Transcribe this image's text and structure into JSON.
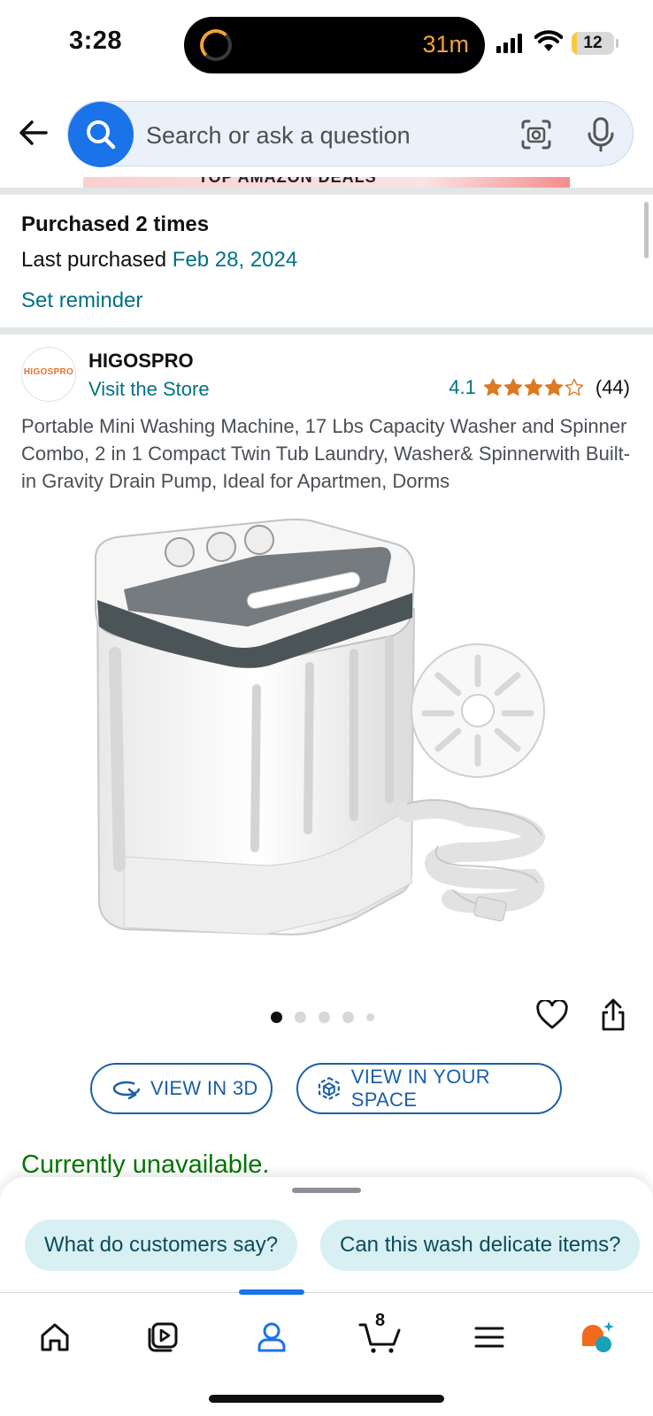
{
  "status_bar": {
    "time": "3:28",
    "activity_text": "31m",
    "battery_level": "12",
    "battery_fraction": 0.12
  },
  "search": {
    "placeholder": "Search or ask a question"
  },
  "purchase_history": {
    "title": "Purchased 2 times",
    "last_purchased_label": "Last purchased",
    "last_purchased_date": "Feb 28, 2024",
    "reminder_link": "Set reminder"
  },
  "brand": {
    "logo_text": "HIGOSPRO",
    "name": "HIGOSPRO",
    "store_link": "Visit the Store"
  },
  "rating": {
    "value": "4.1",
    "stars": 4.1,
    "count": "(44)",
    "star_color": "#de7921"
  },
  "product": {
    "title": "Portable Mini Washing Machine, 17 Lbs Capacity Washer and Spinner Combo, 2 in 1 Compact Twin Tub Laundry, Washer& Spinnerwith Built-in Gravity Drain Pump, Ideal for Apartmen, Dorms",
    "image_count": 5,
    "active_image": 1
  },
  "actions": {
    "view_3d": "VIEW IN 3D",
    "view_space": "VIEW IN YOUR SPACE"
  },
  "availability": {
    "status": "Currently unavailable.",
    "color": "#007600"
  },
  "suggestions": [
    {
      "label": "What do customers say?"
    },
    {
      "label": "Can this wash delicate items?"
    }
  ],
  "bottom_nav": {
    "items": [
      {
        "icon": "home-icon"
      },
      {
        "icon": "play-icon"
      },
      {
        "icon": "account-icon",
        "active": true
      },
      {
        "icon": "cart-icon"
      },
      {
        "icon": "menu-icon"
      },
      {
        "icon": "rufus-icon"
      }
    ],
    "cart_count": "8",
    "accent": "#1a73e8"
  },
  "colors": {
    "link": "#007185",
    "button_outline": "#1a5fa8",
    "chip_bg": "#d8f0f4"
  }
}
